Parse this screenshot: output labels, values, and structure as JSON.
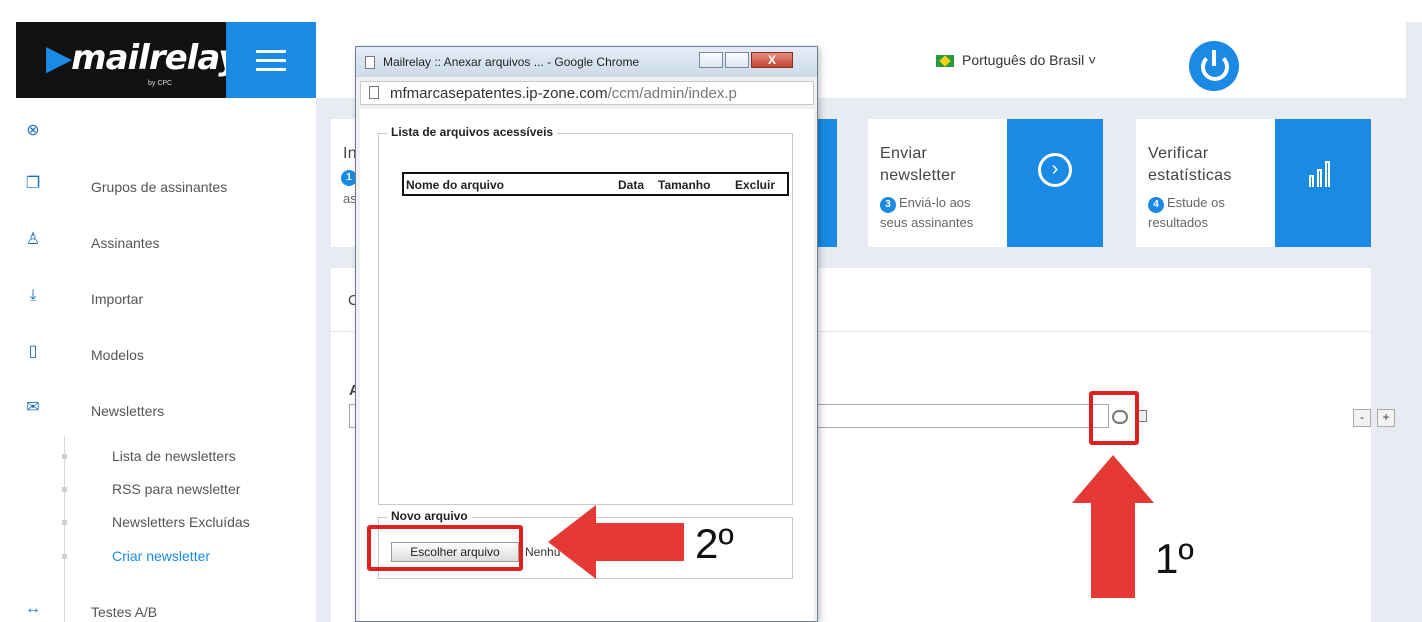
{
  "sidebar": {
    "logo": "mailrelay",
    "logo_sub": "by CPC",
    "items": [
      {
        "label": "",
        "icon": "dashboard-icon"
      },
      {
        "label": "Grupos de assinantes",
        "icon": "groups-icon"
      },
      {
        "label": "Assinantes",
        "icon": "user-icon"
      },
      {
        "label": "Importar",
        "icon": "import-icon"
      },
      {
        "label": "Modelos",
        "icon": "template-icon"
      },
      {
        "label": "Newsletters",
        "icon": "envelope-icon"
      },
      {
        "label": "Testes A/B",
        "icon": "ab-test-icon"
      }
    ],
    "subitems": [
      {
        "label": "Lista de newsletters"
      },
      {
        "label": "RSS para newsletter"
      },
      {
        "label": "Newsletters Excluídas"
      },
      {
        "label": "Criar newsletter",
        "active": true
      }
    ]
  },
  "header": {
    "language": "Português do Brasil ˅"
  },
  "steps": [
    {
      "title_line1": "In",
      "num": "1",
      "sub": "as"
    },
    {
      "title_line1": "Enviar",
      "title_line2": "newsletter",
      "num": "3",
      "sub_line1": "Enviá-lo aos",
      "sub_line2": "seus assinantes"
    },
    {
      "title_line1": "Verificar",
      "title_line2": "estatísticas",
      "num": "4",
      "sub_line1": "Estude os",
      "sub_line2": "resultados"
    }
  ],
  "panel": {
    "fragment1": "C",
    "fragment2": "A",
    "minus": "-",
    "plus": "+"
  },
  "popup": {
    "title": "Mailrelay :: Anexar arquivos ... - Google Chrome",
    "close": "X",
    "address_domain": "mfmarcasepatentes.ip-zone.com",
    "address_path": "/ccm/admin/index.p",
    "accessible_legend": "Lista de arquivos acessíveis",
    "columns": [
      "Nome do arquivo",
      "Data",
      "Tamanho",
      "Excluir"
    ],
    "new_legend": "Novo arquivo",
    "choose_button": "Escolher arquivo",
    "no_file": "Nenhu"
  },
  "annotations": {
    "label1": "1º",
    "label2": "2º"
  },
  "colors": {
    "accent": "#1a8ae5",
    "annotation": "#e53935"
  }
}
